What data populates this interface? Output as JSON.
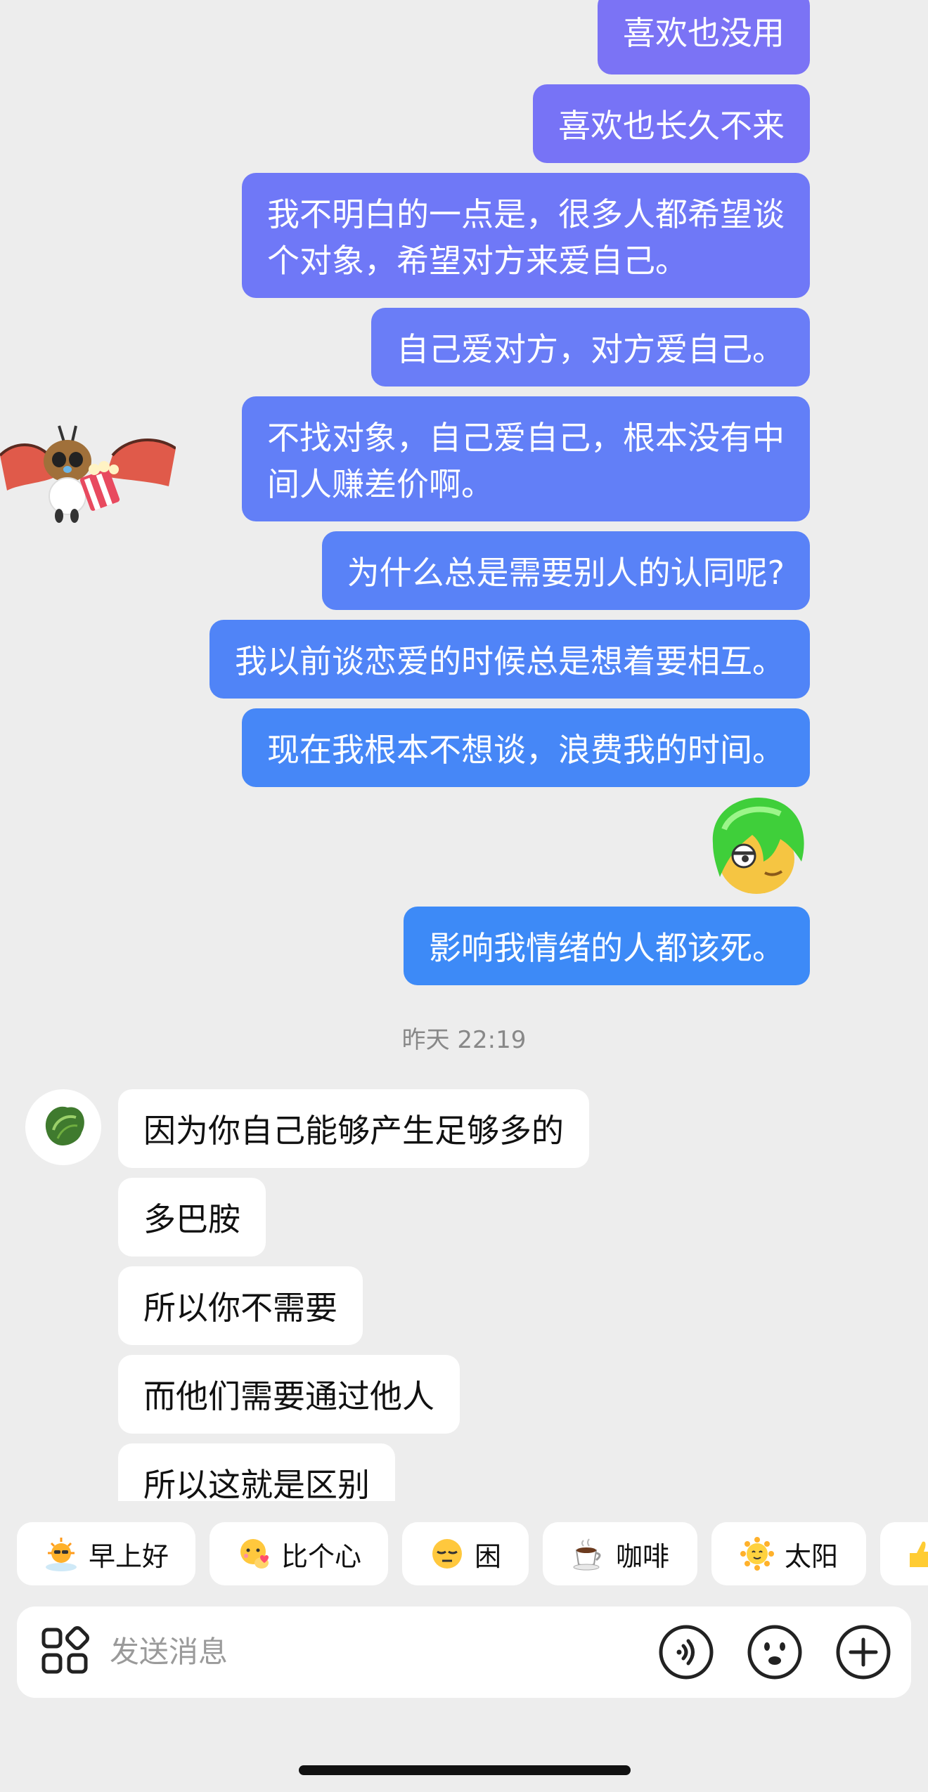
{
  "chat": {
    "outgoing": [
      "喜欢也没用",
      "喜欢也长久不来",
      "我不明白的一点是，很多人都希望谈\n个对象，希望对方来爱自己。",
      "自己爱对方，对方爱自己。",
      "不找对象，自己爱自己，根本没有中\n间人赚差价啊。",
      "为什么总是需要别人的认同呢?",
      "我以前谈恋爱的时候总是想着要相互。",
      "现在我根本不想谈，浪费我的时间。",
      "影响我情绪的人都该死。"
    ],
    "timestamp": "昨天 22:19",
    "incoming": [
      "因为你自己能够产生足够多的",
      "多巴胺",
      "所以你不需要",
      "而他们需要通过他人",
      "所以这就是区别"
    ]
  },
  "quick_replies": [
    {
      "label": "早上好",
      "icon": "sunrise-emoji"
    },
    {
      "label": "比个心",
      "icon": "heart-hand-emoji"
    },
    {
      "label": "困",
      "icon": "sleepy-emoji"
    },
    {
      "label": "咖啡",
      "icon": "coffee-emoji"
    },
    {
      "label": "太阳",
      "icon": "sun-emoji"
    },
    {
      "label": "",
      "icon": "thumbs-emoji"
    }
  ],
  "input": {
    "placeholder": "发送消息"
  },
  "colors": {
    "background": "#ededed",
    "outgoing_bubble_top": "#7b73f7",
    "outgoing_bubble_bottom": "#3d8af7",
    "incoming_bubble": "#ffffff"
  }
}
